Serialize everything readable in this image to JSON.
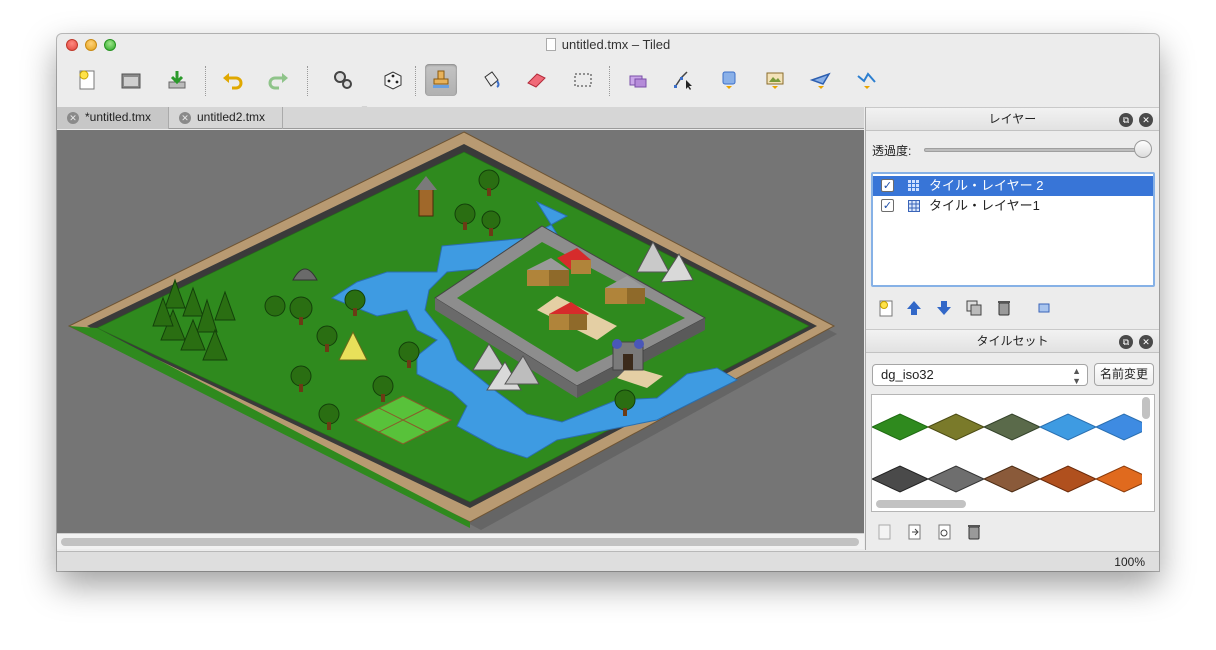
{
  "window": {
    "title": "untitled.tmx – Tiled"
  },
  "toolbar": {
    "buttons": [
      {
        "name": "new-map",
        "icon": "new-document-icon"
      },
      {
        "name": "open",
        "icon": "open-folder-icon"
      },
      {
        "name": "save",
        "icon": "save-download-icon"
      },
      {
        "name": "undo",
        "icon": "undo-arrow-icon"
      },
      {
        "name": "redo",
        "icon": "redo-arrow-icon"
      },
      {
        "name": "commands",
        "icon": "gears-icon"
      },
      {
        "name": "random-mode",
        "icon": "dice-icon"
      },
      {
        "name": "stamp-brush",
        "icon": "stamp-icon",
        "active": true
      },
      {
        "name": "bucket-fill",
        "icon": "bucket-fill-icon"
      },
      {
        "name": "eraser",
        "icon": "eraser-icon"
      },
      {
        "name": "rectangle-select",
        "icon": "rectangle-select-icon"
      },
      {
        "name": "select-objects",
        "icon": "select-objects-icon"
      },
      {
        "name": "edit-polygons",
        "icon": "edit-polygons-icon"
      },
      {
        "name": "insert-rectangle",
        "icon": "insert-rectangle-icon"
      },
      {
        "name": "insert-image",
        "icon": "insert-image-icon"
      },
      {
        "name": "insert-polygon",
        "icon": "insert-polygon-icon"
      },
      {
        "name": "insert-polyline",
        "icon": "insert-polyline-icon"
      }
    ]
  },
  "tabs": [
    {
      "label": "*untitled.tmx",
      "active": true
    },
    {
      "label": "untitled2.tmx",
      "active": false
    }
  ],
  "layers_panel": {
    "title": "レイヤー",
    "opacity_label": "透過度:",
    "opacity": 1.0,
    "layers": [
      {
        "name": "タイル・レイヤー 2",
        "visible": true,
        "selected": true
      },
      {
        "name": "タイル・レイヤー1",
        "visible": true,
        "selected": false
      }
    ]
  },
  "tileset_panel": {
    "title": "タイルセット",
    "selected_tileset": "dg_iso32",
    "rename_label": "名前変更"
  },
  "status": {
    "zoom": "100%"
  },
  "colors": {
    "canvas_bg": "#757575",
    "grass": "#2f8a1e",
    "water": "#3e9be2",
    "wall": "#b89a72",
    "selection": "#3875d7"
  }
}
